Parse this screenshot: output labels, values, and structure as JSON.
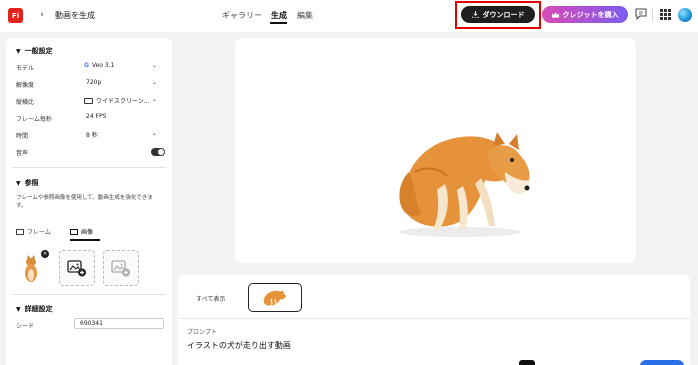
{
  "header": {
    "logo_text": "Fi",
    "title": "動画を生成",
    "tabs": [
      {
        "label": "ギャラリー"
      },
      {
        "label": "生成",
        "active": true
      },
      {
        "label": "編集"
      }
    ],
    "download_label": "ダウンロード",
    "buy_credits_label": "クレジットを購入"
  },
  "settings": {
    "general": {
      "heading": "一般設定",
      "rows": [
        {
          "label": "モデル",
          "value": "Veo 3.1"
        },
        {
          "label": "解像度",
          "value": "720p"
        },
        {
          "label": "縦横比",
          "value": "ワイドスクリーン..."
        },
        {
          "label": "フレーム毎秒",
          "value": "24 FPS"
        },
        {
          "label": "時間",
          "value": "8 秒"
        },
        {
          "label": "音声",
          "toggle_on": true
        }
      ]
    },
    "reference": {
      "heading": "参照",
      "description": "フレームや参照画像を使用して、動画生成を強化できます。",
      "tabs": [
        {
          "label": "フレーム"
        },
        {
          "label": "画像",
          "active": true
        }
      ]
    },
    "advanced": {
      "heading": "詳細設定",
      "seed_label": "シード",
      "seed_value": "690341"
    }
  },
  "bottom": {
    "show_all": "すべて表示",
    "prompt_label": "プロンプト",
    "prompt_text": "イラストの犬が走り出す動画"
  },
  "colors": {
    "logo": "#e2231a",
    "download_bg": "#1f1f1f",
    "highlight_border": "#e00000",
    "credit_gradient": [
      "#d94bb5",
      "#7b5cf0"
    ],
    "primary_blue": "#2a6ee8"
  }
}
